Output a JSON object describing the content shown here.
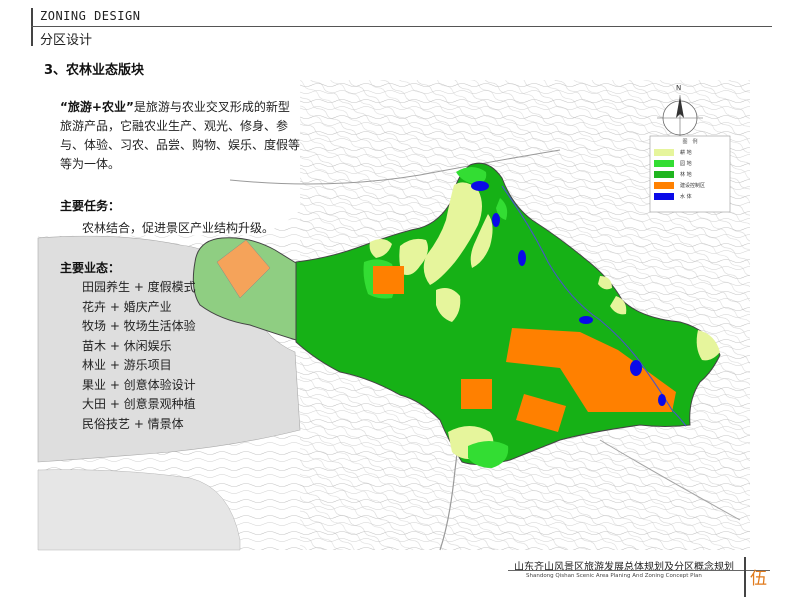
{
  "header": {
    "title_en": "ZONING DESIGN",
    "title_cn": "分区设计"
  },
  "panel": {
    "title": "3、农林业态版块",
    "intro_highlight": "“旅游+农业”",
    "intro_text": "是旅游与农业交叉形成的新型旅游产品，它融农业生产、观光、修身、参与、体验、习农、品尝、购物、娱乐、度假等等为一体。",
    "task_title": "主要任务：",
    "task_text": "农林结合，促进景区产业结构升级。",
    "business_title": "主要业态：",
    "business_items": [
      "田园养生 + 度假模式",
      "花卉 + 婚庆产业",
      "牧场 + 牧场生活体验",
      "苗木 + 休闲娱乐",
      "林业 + 游乐项目",
      "果业 + 创意体验设计",
      "大田 + 创意景观种植",
      "民俗技艺 + 情景体"
    ]
  },
  "map": {
    "compass_label": "N",
    "legend_title": "图　例",
    "legend": [
      {
        "label": "耕 地",
        "color": "#e6f59c"
      },
      {
        "label": "园 地",
        "color": "#33dd33"
      },
      {
        "label": "林 地",
        "color": "#1fb51f"
      },
      {
        "label": "建设控制区",
        "color": "#ff8000"
      },
      {
        "label": "水 体",
        "color": "#0a0ae8"
      }
    ]
  },
  "footer": {
    "title_cn": "山东齐山风景区旅游发展总体规划及分区概念规划",
    "title_en": "Shandong Qishan Scenic Area Planing And Zoning Concept Plan",
    "page_number": "伍"
  }
}
